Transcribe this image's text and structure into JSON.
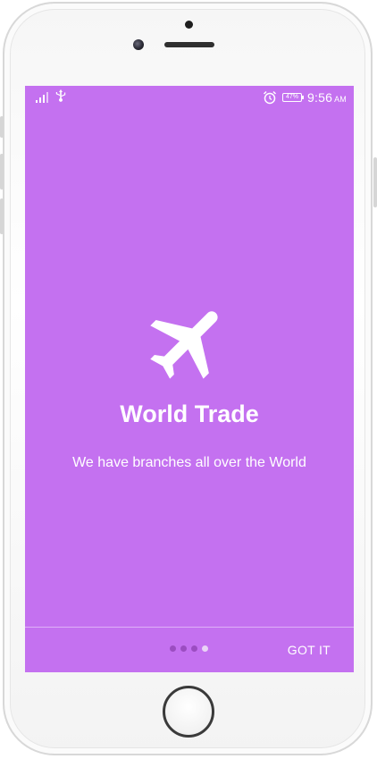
{
  "status_bar": {
    "time": "9:56",
    "ampm": "AM",
    "battery": "47%",
    "icons": [
      "signal-icon",
      "usb-icon",
      "alarm-icon",
      "battery-icon"
    ]
  },
  "onboarding": {
    "icon": "airplane-icon",
    "title": "World Trade",
    "subtitle": "We have branches all over the World",
    "background_color": "#c471f0",
    "page_count": 4,
    "current_page": 4
  },
  "footer": {
    "got_it_label": "GOT IT"
  }
}
